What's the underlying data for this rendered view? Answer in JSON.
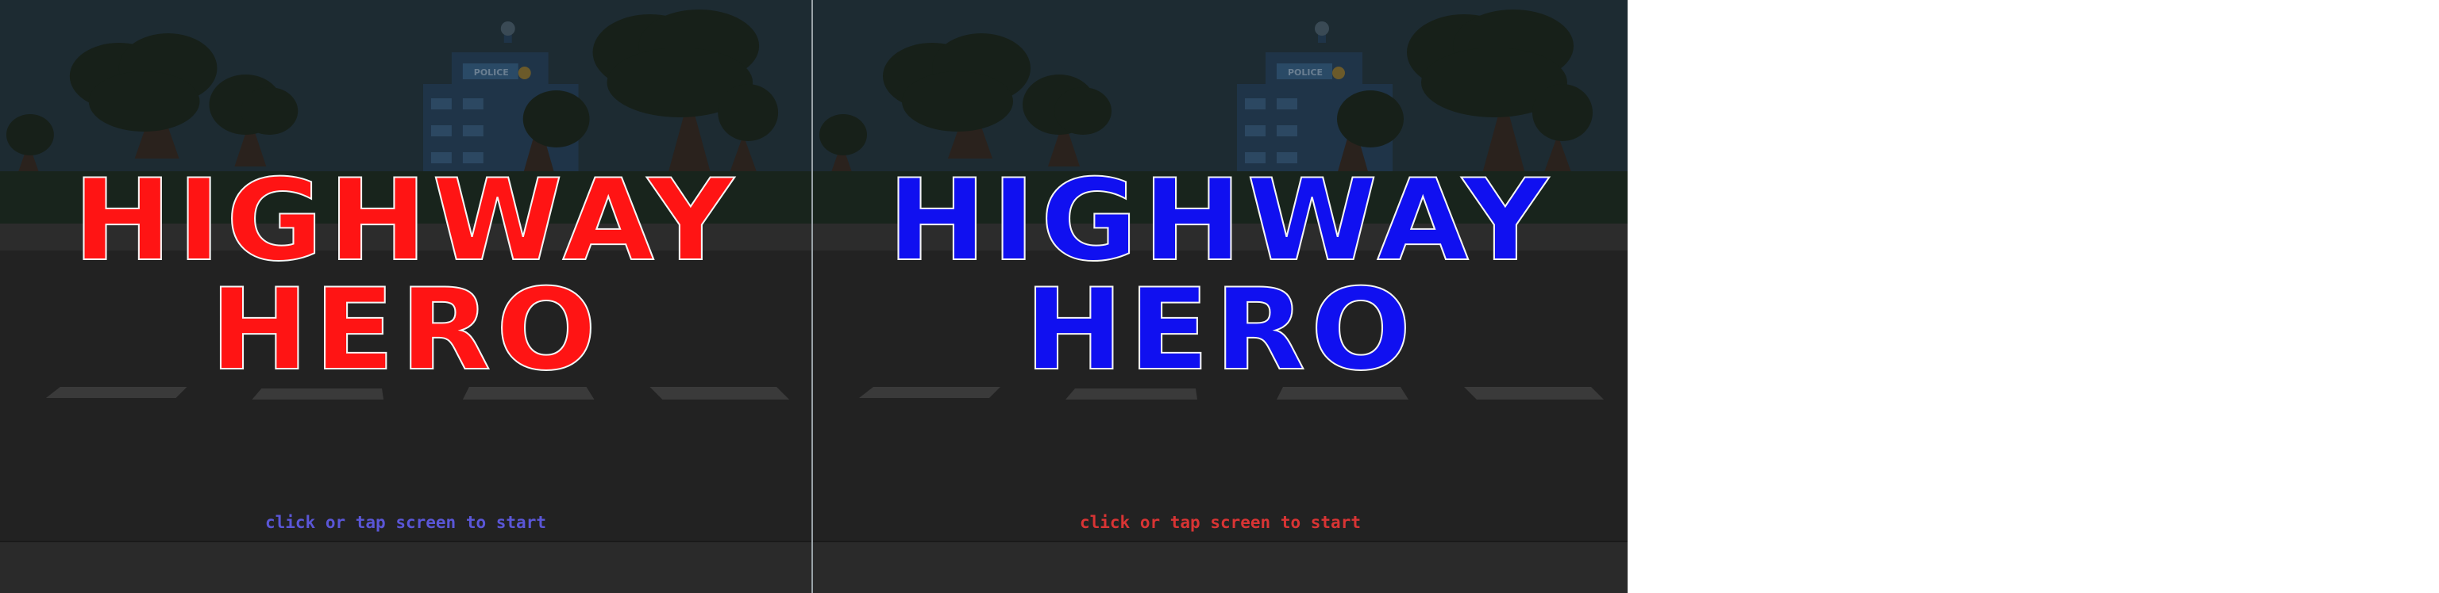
{
  "panels": [
    {
      "id": "left",
      "title_line1": "HIGHWAY",
      "title_line2": "HERO",
      "title_color": "#ff1414",
      "hint": "click or tap screen to start",
      "hint_color": "#5a56d6",
      "building_sign": "POLICE"
    },
    {
      "id": "right",
      "title_line1": "HIGHWAY",
      "title_line2": "HERO",
      "title_color": "#1010f0",
      "hint": "click or tap screen to start",
      "hint_color": "#d83434",
      "building_sign": "POLICE"
    }
  ],
  "colors": {
    "sky": "#1d2b32",
    "tree": "#172019",
    "trunk": "#2a221d",
    "building": "#1f3448",
    "grass": "#18241c",
    "sidewalk": "#2c2c2c",
    "road": "#222222",
    "lane_marking": "#3a3a3a",
    "bottom_band": "#2a2a2a"
  }
}
